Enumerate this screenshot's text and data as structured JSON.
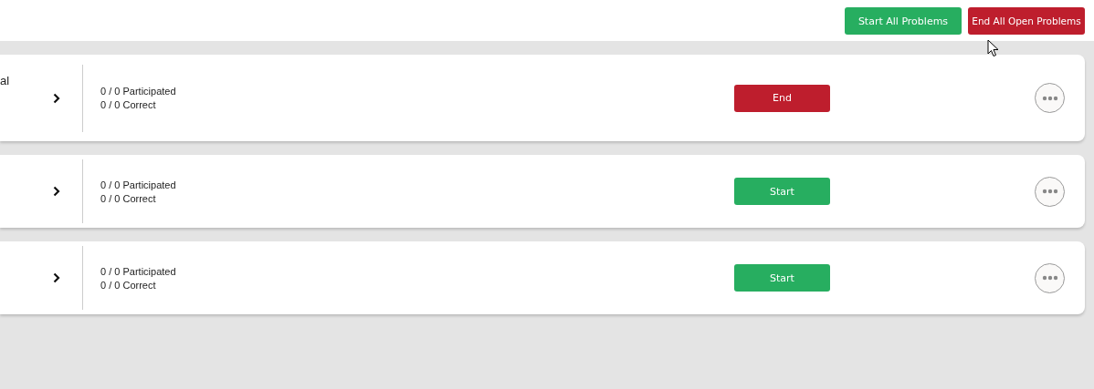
{
  "toolbar": {
    "buttons": [
      {
        "label": "Start All Problems",
        "kind": "start"
      },
      {
        "label": "End All Open Problems",
        "kind": "end"
      }
    ]
  },
  "problems": [
    {
      "title": "al",
      "participated": "0 / 0",
      "participated_label": "Participated",
      "correct": "0 / 0",
      "correct_label": "Correct",
      "action": {
        "label": "End",
        "kind": "end"
      }
    },
    {
      "participated": "0 / 0",
      "participated_label": "Participated",
      "correct": "0 / 0",
      "correct_label": "Correct",
      "action": {
        "label": "Start",
        "kind": "start"
      }
    },
    {
      "participated": "0 / 0",
      "participated_label": "Participated",
      "correct": "0 / 0",
      "correct_label": "Correct",
      "action": {
        "label": "Start",
        "kind": "start"
      }
    }
  ]
}
